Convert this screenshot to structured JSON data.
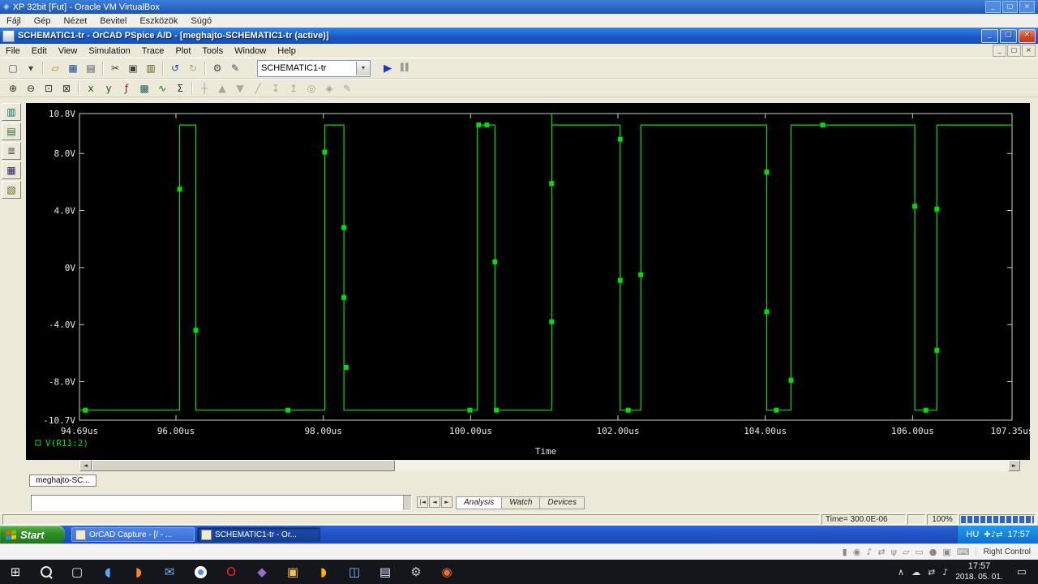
{
  "glyphs": {
    "minimize": "_",
    "restore": "▢",
    "close": "×",
    "dropdown": "▾",
    "run": "▶",
    "pause": "▌▌",
    "arrow_left": "◄",
    "arrow_right": "►",
    "nav_first": "|◄",
    "nav_prev": "◄",
    "nav_next": "►",
    "caret": "∧",
    "action_center": "▭",
    "start_logo": "⊞",
    "task_view": "▢",
    "vb_logo": "◈"
  },
  "vbox": {
    "title": "XP 32bit [Fut] - Oracle VM VirtualBox",
    "menu": [
      {
        "label": "Fájl",
        "name": "vb-menu-fajl"
      },
      {
        "label": "Gép",
        "name": "vb-menu-gep"
      },
      {
        "label": "Nézet",
        "name": "vb-menu-nezet"
      },
      {
        "label": "Bevitel",
        "name": "vb-menu-bevitel"
      },
      {
        "label": "Eszközök",
        "name": "vb-menu-eszkozok"
      },
      {
        "label": "Súgó",
        "name": "vb-menu-sugo"
      }
    ],
    "host_key": "Right Control",
    "status_icons": [
      {
        "name": "hard-disk-icon",
        "glyph": "▮"
      },
      {
        "name": "optical-drive-icon",
        "glyph": "◉"
      },
      {
        "name": "audio-icon",
        "glyph": "♪"
      },
      {
        "name": "network-icon",
        "glyph": "⇄"
      },
      {
        "name": "usb-icon",
        "glyph": "ψ"
      },
      {
        "name": "shared-folders-icon",
        "glyph": "▱"
      },
      {
        "name": "display-icon",
        "glyph": "▭"
      },
      {
        "name": "recording-icon",
        "glyph": "●"
      },
      {
        "name": "mouse-integration-icon",
        "glyph": "▣"
      },
      {
        "name": "host-key-keyboard-icon",
        "glyph": "⌨"
      }
    ]
  },
  "pspice": {
    "title": "SCHEMATIC1-tr - OrCAD PSpice A/D - [meghajto-SCHEMATIC1-tr (active)]",
    "menu": [
      {
        "label": "File",
        "name": "menu-file"
      },
      {
        "label": "Edit",
        "name": "menu-edit"
      },
      {
        "label": "View",
        "name": "menu-view"
      },
      {
        "label": "Simulation",
        "name": "menu-simulation"
      },
      {
        "label": "Trace",
        "name": "menu-trace"
      },
      {
        "label": "Plot",
        "name": "menu-plot"
      },
      {
        "label": "Tools",
        "name": "menu-tools"
      },
      {
        "label": "Window",
        "name": "menu-window"
      },
      {
        "label": "Help",
        "name": "menu-help"
      }
    ],
    "profile_combo": "SCHEMATIC1-tr",
    "window_tab": "meghajto-SC...",
    "status_time": "Time= 300.0E-06",
    "status_progress": "100%",
    "output_tabs": [
      {
        "label": "Analysis",
        "name": "tab-analysis",
        "active": true
      },
      {
        "label": "Watch",
        "name": "tab-watch",
        "active": false
      },
      {
        "label": "Devices",
        "name": "tab-devices",
        "active": false
      }
    ],
    "toolbar_main": [
      {
        "name": "new-simulation-button",
        "glyph": "▢",
        "color": "#445"
      },
      {
        "name": "new-dropdown-arrow",
        "glyph": "▾",
        "color": "#445"
      },
      {
        "sep": true
      },
      {
        "name": "open-button",
        "glyph": "▱",
        "color": "#b08820"
      },
      {
        "name": "save-button",
        "glyph": "▦",
        "color": "#204a98"
      },
      {
        "name": "print-button",
        "glyph": "▤",
        "color": "#505868"
      },
      {
        "sep": true
      },
      {
        "name": "cut-button",
        "glyph": "✂",
        "color": "#404040"
      },
      {
        "name": "copy-button",
        "glyph": "▣",
        "color": "#404040"
      },
      {
        "name": "paste-button",
        "glyph": "▥",
        "color": "#665522"
      },
      {
        "sep": true
      },
      {
        "name": "undo-button",
        "glyph": "↺",
        "color": "#2244cc"
      },
      {
        "name": "redo-button",
        "glyph": "↻",
        "color": "#2244cc",
        "disabled": true
      },
      {
        "sep": true
      },
      {
        "name": "simulation-settings-button",
        "glyph": "⚙",
        "color": "#444444"
      },
      {
        "name": "edit-profile-button",
        "glyph": "✎",
        "color": "#444466"
      }
    ],
    "toolbar_plot": [
      {
        "name": "zoom-in-button",
        "glyph": "⊕",
        "color": "#333"
      },
      {
        "name": "zoom-out-button",
        "glyph": "⊖",
        "color": "#333"
      },
      {
        "name": "zoom-area-button",
        "glyph": "⊡",
        "color": "#333"
      },
      {
        "name": "zoom-fit-button",
        "glyph": "⊠",
        "color": "#333"
      },
      {
        "sep": true
      },
      {
        "name": "log-x-axis-button",
        "glyph": "x",
        "color": "#206020"
      },
      {
        "name": "log-y-axis-button",
        "glyph": "y",
        "color": "#206020"
      },
      {
        "name": "fourier-button",
        "glyph": "ƒ",
        "color": "#802020"
      },
      {
        "name": "performance-analysis-button",
        "glyph": "▩",
        "color": "#206060"
      },
      {
        "name": "add-trace-button",
        "glyph": "∿",
        "color": "#0a820a"
      },
      {
        "name": "evaluate-measurement-button",
        "glyph": "Σ",
        "color": "#333333"
      },
      {
        "sep": true
      },
      {
        "name": "toggle-cursor-button",
        "glyph": "┼",
        "disabled": true
      },
      {
        "name": "cursor-peak-button",
        "glyph": "▲",
        "disabled": true
      },
      {
        "name": "cursor-trough-button",
        "glyph": "▼",
        "disabled": true
      },
      {
        "name": "cursor-slope-button",
        "glyph": "╱",
        "disabled": true
      },
      {
        "name": "cursor-min-button",
        "glyph": "↧",
        "disabled": true
      },
      {
        "name": "cursor-max-button",
        "glyph": "↥",
        "disabled": true
      },
      {
        "name": "cursor-point-button",
        "glyph": "◎",
        "disabled": true
      },
      {
        "name": "cursor-search-button",
        "glyph": "◈",
        "disabled": true
      },
      {
        "name": "mark-label-button",
        "glyph": "✎",
        "disabled": true
      }
    ],
    "left_toolbar": [
      {
        "name": "simulation-results-icon",
        "glyph": "▥",
        "color": "#0a6a6a"
      },
      {
        "name": "circuit-file-icon",
        "glyph": "▤",
        "color": "#2a6a2a"
      },
      {
        "name": "output-file-icon",
        "glyph": "≣",
        "color": "#444444"
      },
      {
        "name": "simulation-queue-icon",
        "glyph": "▦",
        "color": "#222266"
      },
      {
        "name": "output-window-icon",
        "glyph": "▧",
        "color": "#666622"
      }
    ]
  },
  "chart_data": {
    "type": "line",
    "title": "",
    "xlabel": "Time",
    "ylabel": "",
    "xlim": [
      94.69,
      107.35
    ],
    "ylim": [
      -10.7,
      10.8
    ],
    "grid": false,
    "background": "#000000",
    "axis_color": "#d0d0d0",
    "text_color": "#e8e8e8",
    "legend_position": "bottom-left",
    "x_ticks": [
      {
        "v": 94.69,
        "label": "94.69us"
      },
      {
        "v": 96.0,
        "label": "96.00us"
      },
      {
        "v": 98.0,
        "label": "98.00us"
      },
      {
        "v": 100.0,
        "label": "100.00us"
      },
      {
        "v": 102.0,
        "label": "102.00us"
      },
      {
        "v": 104.0,
        "label": "104.00us"
      },
      {
        "v": 106.0,
        "label": "106.00us"
      },
      {
        "v": 107.35,
        "label": "107.35us"
      }
    ],
    "y_ticks": [
      {
        "v": 10.8,
        "label": "10.8V"
      },
      {
        "v": 8.0,
        "label": "8.0V"
      },
      {
        "v": 4.0,
        "label": "4.0V"
      },
      {
        "v": 0.0,
        "label": "0V"
      },
      {
        "v": -4.0,
        "label": "-4.0V"
      },
      {
        "v": -8.0,
        "label": "-8.0V"
      },
      {
        "v": -10.7,
        "label": "-10.7V"
      }
    ],
    "series": [
      {
        "name": "V(R11:2)",
        "color": "#00e000",
        "points": [
          [
            94.69,
            -10
          ],
          [
            96.05,
            -10
          ],
          [
            96.05,
            10
          ],
          [
            96.27,
            10
          ],
          [
            96.27,
            -10
          ],
          [
            98.02,
            -10
          ],
          [
            98.02,
            10
          ],
          [
            98.28,
            10
          ],
          [
            98.28,
            -10
          ],
          [
            100.09,
            -10
          ],
          [
            100.09,
            10
          ],
          [
            100.33,
            10
          ],
          [
            100.33,
            -10
          ],
          [
            101.1,
            -10
          ],
          [
            101.1,
            10.8
          ],
          [
            101.1,
            10
          ],
          [
            102.03,
            10
          ],
          [
            102.03,
            -10
          ],
          [
            102.31,
            -10
          ],
          [
            102.31,
            10
          ],
          [
            104.02,
            10
          ],
          [
            104.02,
            -10
          ],
          [
            104.35,
            -10
          ],
          [
            104.35,
            10
          ],
          [
            106.03,
            10
          ],
          [
            106.03,
            -10
          ],
          [
            106.33,
            -10
          ],
          [
            106.33,
            10
          ],
          [
            107.35,
            10
          ]
        ],
        "markers": [
          [
            94.77,
            -10
          ],
          [
            96.05,
            5.5
          ],
          [
            96.27,
            -4.4
          ],
          [
            97.52,
            -10
          ],
          [
            98.02,
            8.1
          ],
          [
            98.28,
            2.8
          ],
          [
            98.28,
            -2.1
          ],
          [
            98.31,
            -7.0
          ],
          [
            99.99,
            -10
          ],
          [
            100.11,
            10
          ],
          [
            100.22,
            10
          ],
          [
            100.33,
            0.4
          ],
          [
            100.35,
            -10
          ],
          [
            101.1,
            5.9
          ],
          [
            101.1,
            -3.8
          ],
          [
            102.03,
            9.0
          ],
          [
            102.03,
            -0.9
          ],
          [
            102.14,
            -10
          ],
          [
            102.31,
            -0.5
          ],
          [
            104.02,
            6.7
          ],
          [
            104.02,
            -3.1
          ],
          [
            104.15,
            -10
          ],
          [
            104.35,
            -7.9
          ],
          [
            104.78,
            10
          ],
          [
            106.03,
            4.3
          ],
          [
            106.18,
            -10
          ],
          [
            106.33,
            4.1
          ],
          [
            106.33,
            -5.8
          ]
        ]
      }
    ]
  },
  "xp_taskbar": {
    "start_label": "Start",
    "tasks": [
      {
        "label": "OrCAD Capture - [/ - ...",
        "name": "task-orcad-capture",
        "icon": "orcad-capture-icon",
        "active": false
      },
      {
        "label": "SCHEMATIC1-tr - Or...",
        "name": "task-pspice",
        "icon": "pspice-icon",
        "active": true
      }
    ],
    "tray_lang": "HU",
    "tray_time": "17:57",
    "tray_icons": [
      {
        "name": "antivirus-icon",
        "glyph": "✚"
      },
      {
        "name": "volume-icon",
        "glyph": "♪"
      },
      {
        "name": "network-icon",
        "glyph": "⇄"
      }
    ]
  },
  "host_taskbar": {
    "time": "17:57",
    "date": "2018. 05. 01.",
    "pinned": [
      {
        "name": "thunderbird-icon",
        "glyph": "◖",
        "color": "#58aaff"
      },
      {
        "name": "firefox-icon",
        "glyph": "◗",
        "color": "#ff8b1f"
      },
      {
        "name": "mail-icon",
        "glyph": "✉",
        "color": "#6cb2f0"
      },
      {
        "name": "chrome-icon",
        "css": "chrome-dot"
      },
      {
        "name": "opera-icon",
        "glyph": "O",
        "color": "#ff1b2d"
      },
      {
        "name": "vscode-icon",
        "glyph": "◆",
        "color": "#9a6bd0"
      },
      {
        "name": "explorer-icon",
        "glyph": "▣",
        "color": "#f2c14b"
      },
      {
        "name": "firefox-nightly-icon",
        "glyph": "◗",
        "color": "#ffb300"
      },
      {
        "name": "database-icon",
        "glyph": "◫",
        "color": "#7db8ff"
      },
      {
        "name": "notes-icon",
        "glyph": "▤",
        "color": "#d8e8ff"
      },
      {
        "name": "settings-icon",
        "glyph": "⚙",
        "color": "#c8c8c8"
      },
      {
        "name": "browser-icon",
        "glyph": "◉",
        "color": "#ff6a2a"
      }
    ],
    "tray_icons": [
      {
        "name": "hidden-icons-caret",
        "glyph": "∧"
      },
      {
        "name": "onedrive-icon",
        "glyph": "☁"
      },
      {
        "name": "network-icon",
        "glyph": "⇄"
      },
      {
        "name": "volume-icon",
        "glyph": "♪"
      }
    ]
  }
}
